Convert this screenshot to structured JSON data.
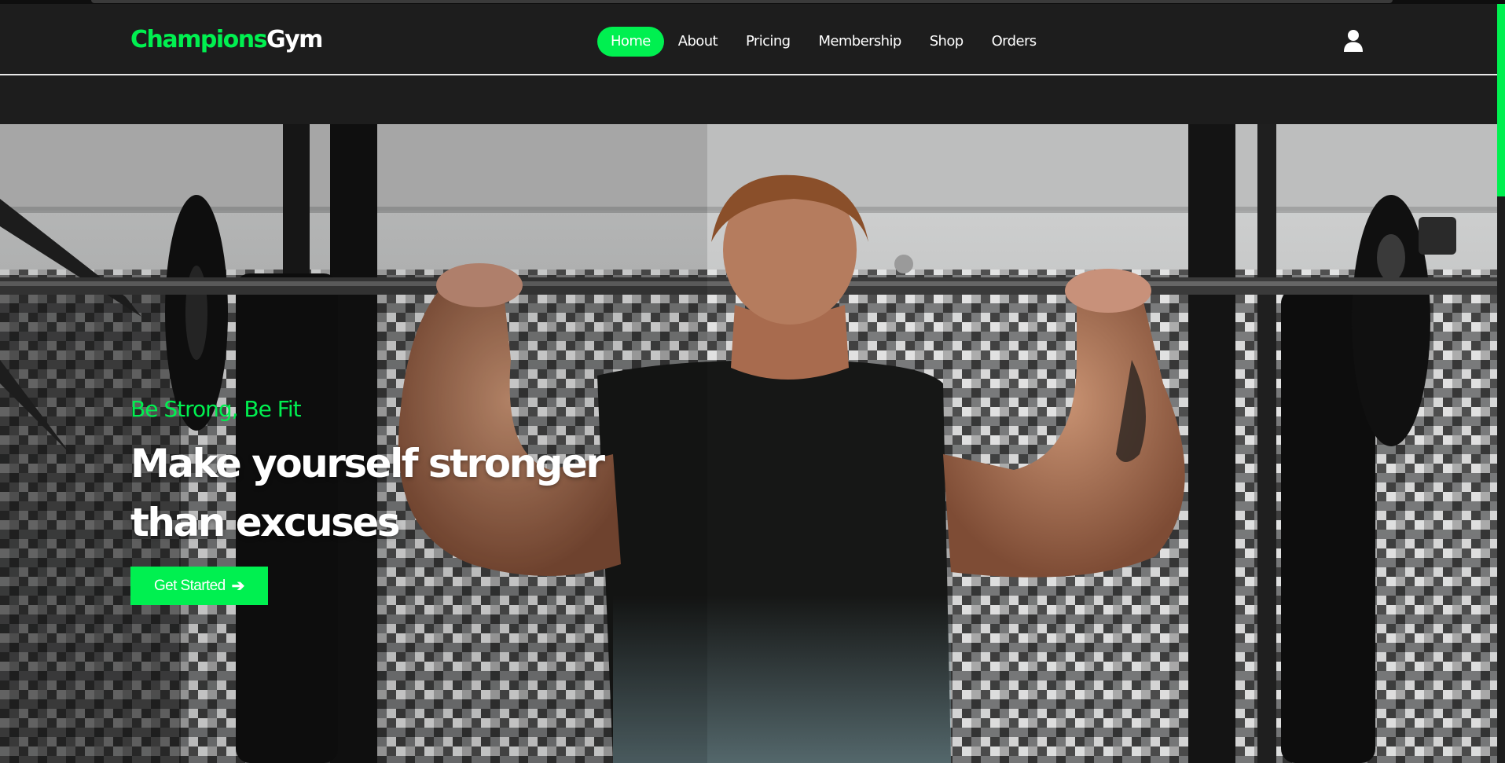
{
  "brand": {
    "part1": "Champions",
    "part2": "Gym"
  },
  "nav": {
    "items": [
      {
        "label": "Home",
        "active": true
      },
      {
        "label": "About",
        "active": false
      },
      {
        "label": "Pricing",
        "active": false
      },
      {
        "label": "Membership",
        "active": false
      },
      {
        "label": "Shop",
        "active": false
      },
      {
        "label": "Orders",
        "active": false
      }
    ],
    "user_icon": "user-icon"
  },
  "hero": {
    "tagline": "Be Strong, Be Fit",
    "title_line1": "Make yourself stronger",
    "title_line2": "than excuses",
    "cta_label": "Get Started",
    "cta_icon": "arrow-right-icon",
    "image": "man-doing-pull-ups-in-gym"
  },
  "colors": {
    "accent": "#00f050",
    "background": "#1d1d1d",
    "text": "#ffffff"
  }
}
